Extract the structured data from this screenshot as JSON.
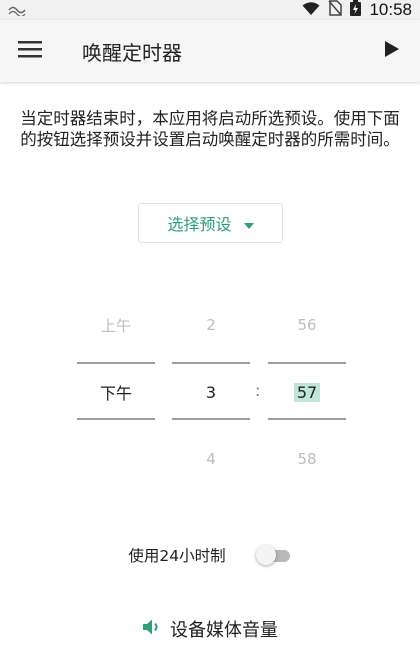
{
  "status_bar": {
    "time": "10:58"
  },
  "app_bar": {
    "title": "唤醒定时器"
  },
  "description": "当定时器结束时，本应用将启动所选预设。使用下面的按钮选择预设并设置启动唤醒定时器的所需时间。",
  "preset_button": {
    "label": "选择预设"
  },
  "picker": {
    "ampm": {
      "prev": "上午",
      "selected": "下午",
      "next": ""
    },
    "hour": {
      "prev": "2",
      "selected": "3",
      "next": "4"
    },
    "separator": ":",
    "minute": {
      "prev": "56",
      "selected": "57",
      "next": "58"
    }
  },
  "toggle_24h": {
    "label": "使用24小时制",
    "on": false
  },
  "media_volume": {
    "label": "设备媒体音量"
  },
  "colors": {
    "accent": "#2e9e7c",
    "highlight": "#bfe6d7"
  }
}
